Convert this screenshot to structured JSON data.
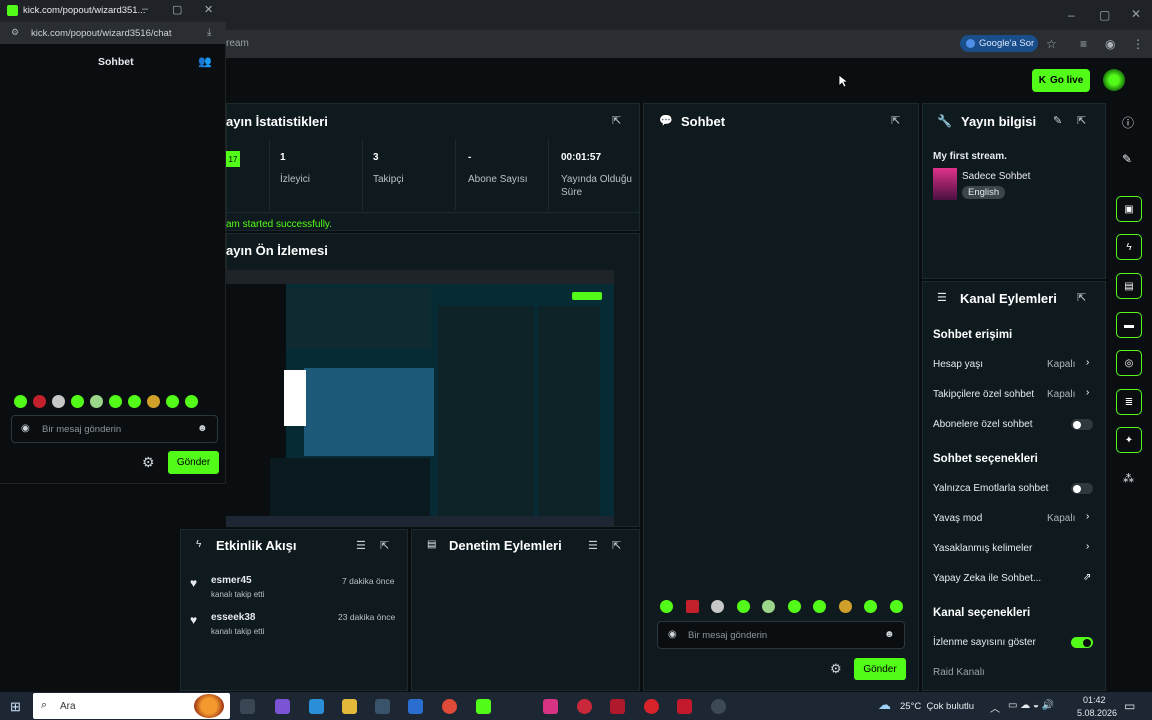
{
  "popup": {
    "window_title": "kick.com/popout/wizard351...",
    "url": "kick.com/popout/wizard3516/chat",
    "chat_title": "Sohbet",
    "input_placeholder": "Bir mesaj gönderin",
    "send_label": "Gönder"
  },
  "browser": {
    "addr_fragment": "ream",
    "google_pill": "Google'a Sor"
  },
  "header": {
    "go_live": "Go live"
  },
  "stats": {
    "title": "ayın İstatistikleri",
    "badge": "17",
    "items": [
      {
        "value": "1",
        "label": "İzleyici"
      },
      {
        "value": "3",
        "label": "Takipçi"
      },
      {
        "value": "-",
        "label": "Abone Sayısı"
      },
      {
        "value": "00:01:57",
        "label": "Yayında Olduğu Süre"
      }
    ],
    "status": "am started successfully."
  },
  "preview": {
    "title": "ayın Ön İzlemesi"
  },
  "chat": {
    "title": "Sohbet",
    "input_placeholder": "Bir mesaj gönderin",
    "send_label": "Gönder"
  },
  "stream_info": {
    "title": "Yayın bilgisi",
    "stream_name": "My first stream.",
    "category": "Sadece Sohbet",
    "language": "English"
  },
  "channel_actions": {
    "title": "Kanal Eylemleri",
    "chat_access_heading": "Sohbet erişimi",
    "rows_access": [
      {
        "label": "Hesap yaşı",
        "value": "Kapalı"
      },
      {
        "label": "Takipçilere özel sohbet",
        "value": "Kapalı"
      },
      {
        "label": "Abonelere özel sohbet",
        "value": ""
      }
    ],
    "chat_options_heading": "Sohbet seçenekleri",
    "rows_options": [
      {
        "label": "Yalnızca Emotlarla sohbet",
        "value": ""
      },
      {
        "label": "Yavaş mod",
        "value": "Kapalı"
      },
      {
        "label": "Yasaklanmış kelimeler",
        "value": ""
      },
      {
        "label": "Yapay Zeka ile Sohbet...",
        "value": ""
      }
    ],
    "channel_options_heading": "Kanal seçenekleri",
    "rows_channel": [
      {
        "label": "İzlenme sayısını göster",
        "value": ""
      },
      {
        "label": "Raid Kanalı",
        "value": ""
      }
    ]
  },
  "activity": {
    "title": "Etkinlik Akışı",
    "items": [
      {
        "user": "esmer45",
        "action": "kanalı takip etti",
        "time": "7 dakika önce"
      },
      {
        "user": "esseek38",
        "action": "kanalı takip etti",
        "time": "23 dakika önce"
      }
    ]
  },
  "moderation": {
    "title": "Denetim Eylemleri"
  },
  "taskbar": {
    "search": "Ara",
    "weather": "25°C  Çok bulutlu",
    "time": "01:42",
    "date": "5.08.2026"
  },
  "colors": {
    "accent": "#53fc18",
    "panel": "#0f1a1e"
  }
}
